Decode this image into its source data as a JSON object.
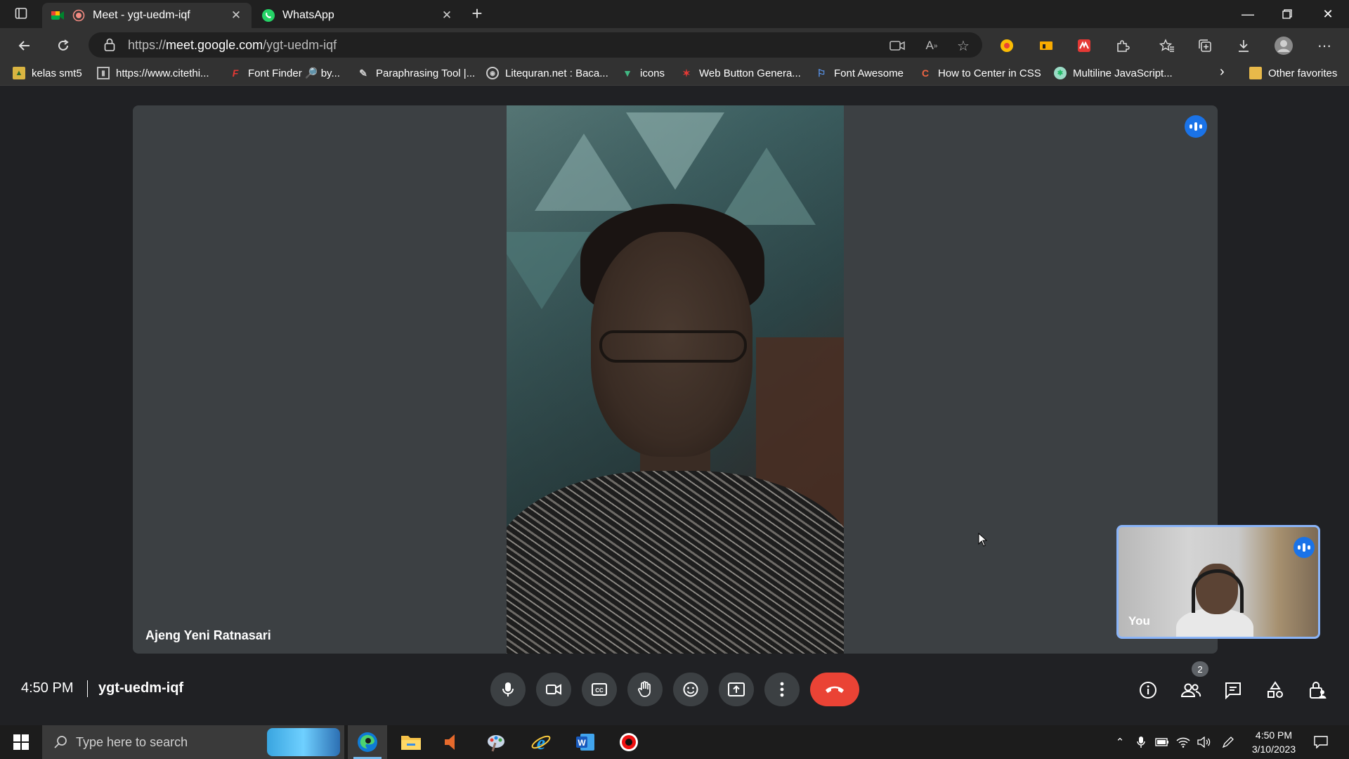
{
  "browser": {
    "tabs": [
      {
        "label": "Meet - ygt-uedm-iqf",
        "active": true
      },
      {
        "label": "WhatsApp",
        "active": false
      }
    ],
    "url_prefix": "https://",
    "url_host": "meet.google.com",
    "url_path": "/ygt-uedm-iqf",
    "favorites": [
      {
        "label": "kelas smt5",
        "icon": "folder-icon"
      },
      {
        "label": "https://www.citethi...",
        "icon": "citethis-icon"
      },
      {
        "label": "Font Finder 🔎 by...",
        "icon": "font-finder-icon"
      },
      {
        "label": "Paraphrasing Tool |...",
        "icon": "quill-icon"
      },
      {
        "label": "Litequran.net : Baca...",
        "icon": "litequran-icon"
      },
      {
        "label": "icons",
        "icon": "vue-icon"
      },
      {
        "label": "Web Button Genera...",
        "icon": "star-icon"
      },
      {
        "label": "Font Awesome",
        "icon": "flag-icon"
      },
      {
        "label": "How to Center in CSS",
        "icon": "css-icon"
      },
      {
        "label": "Multiline JavaScript...",
        "icon": "js-icon"
      }
    ],
    "other_favorites": "Other favorites"
  },
  "meet": {
    "participant_name": "Ajeng Yeni Ratnasari",
    "self_label": "You",
    "time": "4:50 PM",
    "meeting_code": "ygt-uedm-iqf",
    "participant_count": "2",
    "colors": {
      "background": "#202124",
      "tile": "#3c4043",
      "accent": "#1a73e8",
      "end_call": "#ea4335"
    }
  },
  "taskbar": {
    "search_placeholder": "Type here to search",
    "time": "4:50 PM",
    "date": "3/10/2023"
  }
}
